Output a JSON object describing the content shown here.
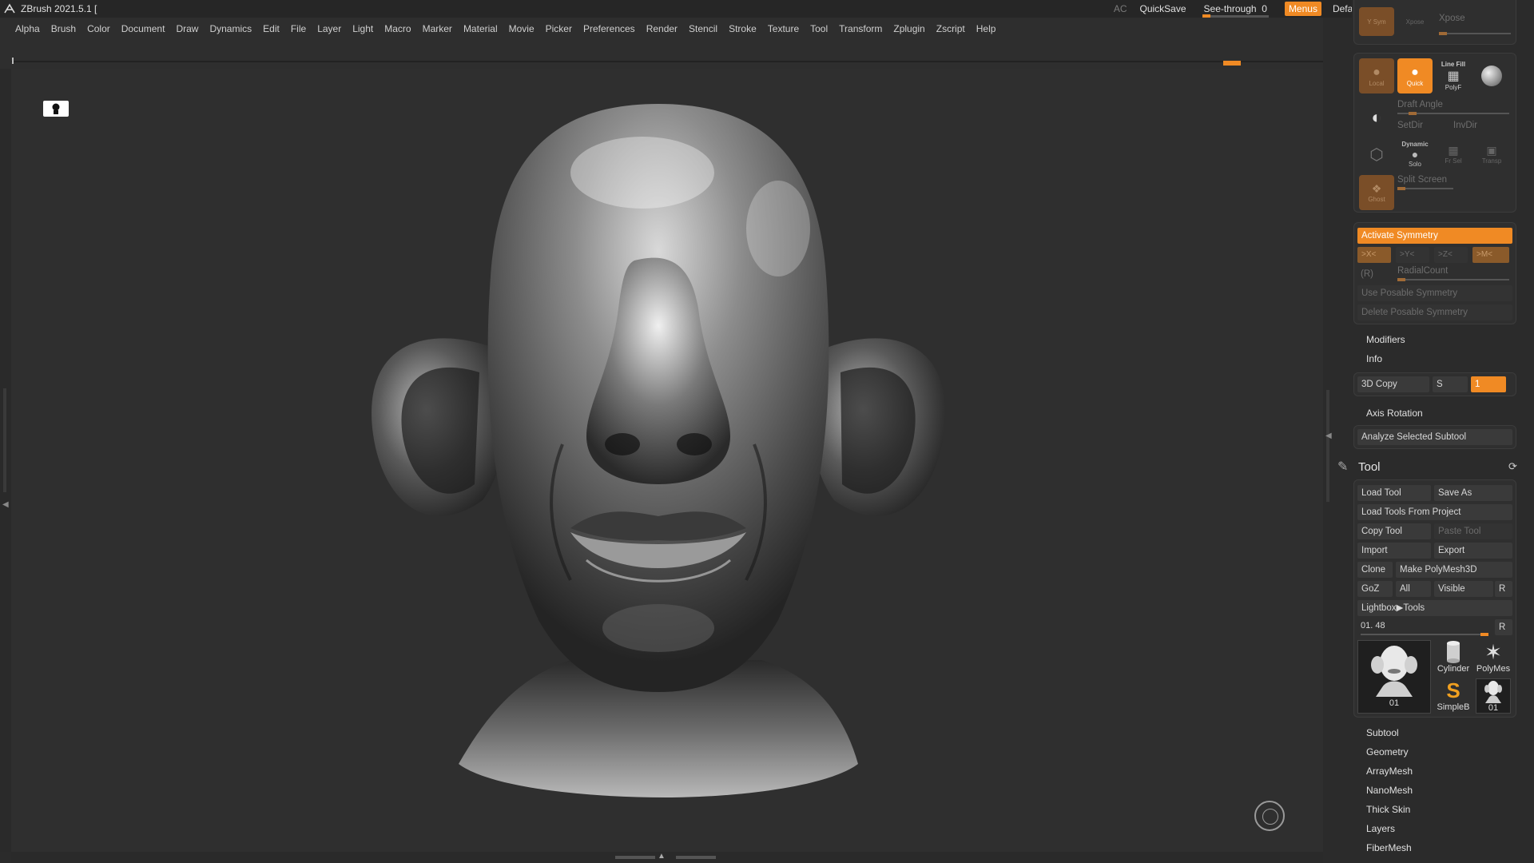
{
  "titlebar": {
    "title": "ZBrush 2021.5.1 [",
    "ac": "AC",
    "quicksave": "QuickSave",
    "seethrough_label": "See-through",
    "seethrough_value": "0",
    "menus": "Menus",
    "script": "DefaultZScript"
  },
  "menubar": [
    "Alpha",
    "Brush",
    "Color",
    "Document",
    "Draw",
    "Dynamics",
    "Edit",
    "File",
    "Layer",
    "Light",
    "Macro",
    "Marker",
    "Material",
    "Movie",
    "Picker",
    "Preferences",
    "Render",
    "Stencil",
    "Stroke",
    "Texture",
    "Tool",
    "Transform",
    "Zplugin",
    "Zscript",
    "Help"
  ],
  "panel": {
    "top": {
      "vsym": "Y Sym",
      "xpose": "Xpose",
      "xpose2": "Xpose"
    },
    "transp_group": {
      "local": "Local",
      "quick": "Quick",
      "line_fill": "Line Fill",
      "polyf": "PolyF",
      "draft_angle": "Draft Angle",
      "setdir": "SetDir",
      "invdir": "InvDir",
      "dynamic": "Dynamic",
      "solo": "Solo",
      "frsel": "Fr Sel",
      "transp": "Transp",
      "ghost": "Ghost",
      "split_screen": "Split Screen"
    },
    "symmetry": {
      "activate": "Activate Symmetry",
      "x": ">X<",
      "y": ">Y<",
      "z": ">Z<",
      "m": ">M<",
      "r": "(R)",
      "radial": "RadialCount",
      "use_posable": "Use Posable Symmetry",
      "delete_posable": "Delete Posable Symmetry"
    },
    "modifiers": "Modifiers",
    "info": "Info",
    "copy3d": {
      "label": "3D Copy",
      "s": "S",
      "value": "1"
    },
    "axis_rotation": "Axis Rotation",
    "analyze": "Analyze Selected Subtool",
    "tool": {
      "title": "Tool",
      "load_tool": "Load Tool",
      "save_as": "Save As",
      "load_from_project": "Load Tools From Project",
      "copy_tool": "Copy Tool",
      "paste_tool": "Paste Tool",
      "import": "Import",
      "export": "Export",
      "clone": "Clone",
      "make_polymesh": "Make PolyMesh3D",
      "goz": "GoZ",
      "all": "All",
      "visible": "Visible",
      "r": "R",
      "lightbox_tools": "Lightbox▶Tools",
      "current_tool": "01. 48",
      "r2": "R",
      "thumbs": {
        "main": "01",
        "cylinder": "Cylinder",
        "polymesh": "PolyMes",
        "simpleb": "SimpleB",
        "small01": "01"
      }
    },
    "subpalettes": [
      "Subtool",
      "Geometry",
      "ArrayMesh",
      "NanoMesh",
      "Thick Skin",
      "Layers",
      "FiberMesh"
    ]
  }
}
